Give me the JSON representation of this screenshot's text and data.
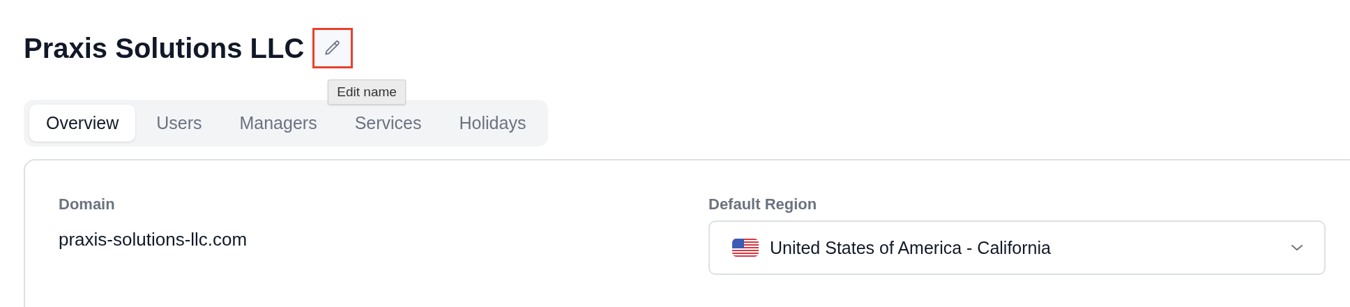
{
  "title": "Praxis Solutions LLC",
  "edit_button": {
    "highlighted": true,
    "tooltip": "Edit name"
  },
  "tabs": [
    {
      "label": "Overview",
      "selected": true
    },
    {
      "label": "Users",
      "selected": false
    },
    {
      "label": "Managers",
      "selected": false
    },
    {
      "label": "Services",
      "selected": false
    },
    {
      "label": "Holidays",
      "selected": false
    }
  ],
  "overview": {
    "domain": {
      "label": "Domain",
      "value": "praxis-solutions-llc.com"
    },
    "default_region": {
      "label": "Default Region",
      "value": "United States of America - California"
    }
  }
}
